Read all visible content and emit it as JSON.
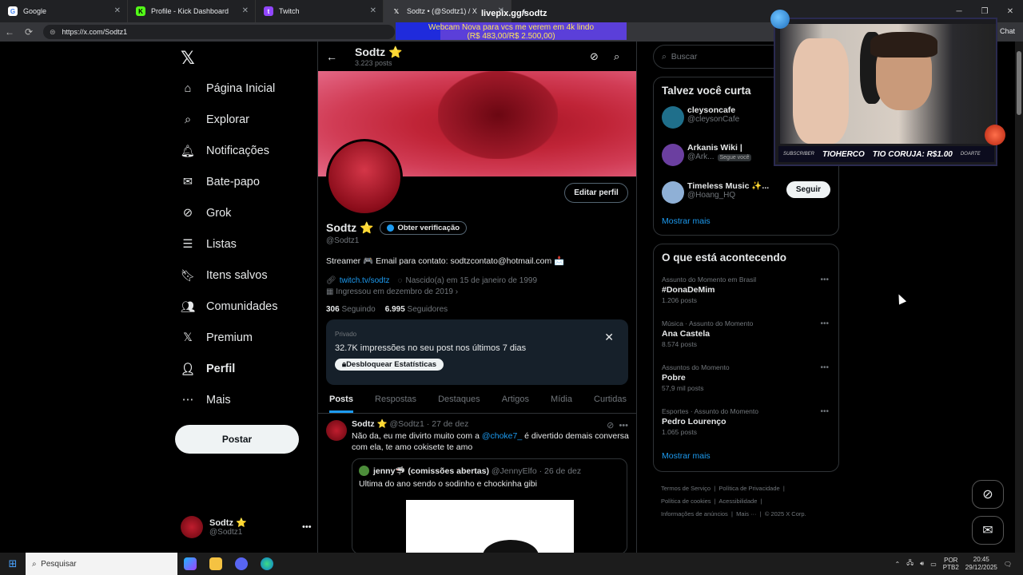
{
  "browser": {
    "tabs": [
      {
        "title": "Google",
        "icon": "google-icon",
        "color": "#ffffff"
      },
      {
        "title": "Profile - Kick Dashboard",
        "icon": "kick-icon",
        "color": "#53fc18"
      },
      {
        "title": "Twitch",
        "icon": "twitch-icon",
        "color": "#9146ff"
      },
      {
        "title": "Sodtz • (@Sodtz1) / X",
        "icon": "x-icon",
        "color": "#ffffff"
      }
    ],
    "overlay_title": "livepix.gg/sodtz",
    "url": "https://x.com/Sodtz1",
    "chat_label": "Chat"
  },
  "banner": {
    "line1": "Webcam Nova para vcs me verem em 4k lindo",
    "line2": "(R$ 483,00/R$ 2.500,00)",
    "progress": 0.1932
  },
  "sidebar": {
    "logo": "X",
    "items": [
      {
        "label": "Página Inicial",
        "icon": "home-icon"
      },
      {
        "label": "Explorar",
        "icon": "search-icon"
      },
      {
        "label": "Notificações",
        "icon": "bell-icon"
      },
      {
        "label": "Bate-papo",
        "icon": "mail-icon"
      },
      {
        "label": "Grok",
        "icon": "grok-icon"
      },
      {
        "label": "Listas",
        "icon": "list-icon"
      },
      {
        "label": "Itens salvos",
        "icon": "bookmark-icon"
      },
      {
        "label": "Comunidades",
        "icon": "people-icon"
      },
      {
        "label": "Premium",
        "icon": "x-premium-icon"
      },
      {
        "label": "Perfil",
        "icon": "person-icon"
      },
      {
        "label": "Mais",
        "icon": "more-circle-icon"
      }
    ],
    "post_button": "Postar",
    "account": {
      "name": "Sodtz ⭐",
      "handle": "@Sodtz1"
    }
  },
  "profile": {
    "name": "Sodtz ⭐",
    "posts_count": "3.223 posts",
    "edit_button": "Editar perfil",
    "verify_button": "Obter verificação",
    "handle": "@Sodtz1",
    "bio": "Streamer 🎮 Email para contato: sodtzcontato@hotmail.com 📩",
    "link": "twitch.tv/sodtz",
    "birth": "Nascido(a) em 15 de janeiro de 1999",
    "joined": "Ingressou em dezembro de 2019",
    "following_count": "306",
    "following_label": "Seguindo",
    "followers_count": "6.995",
    "followers_label": "Seguidores"
  },
  "private_card": {
    "label": "Privado",
    "text": "32.7K impressões no seu post nos últimos 7 dias",
    "button": "Desbloquear Estatísticas"
  },
  "tabs": [
    "Posts",
    "Respostas",
    "Destaques",
    "Artigos",
    "Mídia",
    "Curtidas"
  ],
  "tweet": {
    "name": "Sodtz ⭐",
    "handle": "@Sodtz1",
    "date": "27 de dez",
    "text_before": "Não da, eu me divirto muito com a ",
    "mention": "@choke7_",
    "text_after": " é divertido demais conversa com ela, te amo cokisete te amo",
    "quote": {
      "name": "jenny🦈 (comissões abertas)",
      "handle": "@JennyElfo",
      "date": "26 de dez",
      "text": "Ultima do ano sendo o sodinho e chockinha gibi"
    }
  },
  "right": {
    "search_placeholder": "Buscar",
    "who_title": "Talvez você curta",
    "who": [
      {
        "name": "cleysoncafe",
        "handle": "@cleysonCafe",
        "color": "#1f6f8b"
      },
      {
        "name": "Arkanis Wiki |",
        "handle": "@Ark...",
        "badge": "Segue você",
        "color": "#6b3fa0"
      },
      {
        "name": "Timeless Music ✨...",
        "handle": "@Hoang_HQ",
        "color": "#8fb0d6",
        "button": "Seguir"
      }
    ],
    "show_more": "Mostrar mais",
    "trends_title": "O que está acontecendo",
    "trends": [
      {
        "context": "Assunto do Momento em Brasil",
        "topic": "#DonaDeMim",
        "posts": "1.206 posts"
      },
      {
        "context": "Música · Assunto do Momento",
        "topic": "Ana Castela",
        "posts": "8.574 posts"
      },
      {
        "context": "Assuntos do Momento",
        "topic": "Pobre",
        "posts": "57,9 mil posts"
      },
      {
        "context": "Esportes · Assunto do Momento",
        "topic": "Pedro Lourenço",
        "posts": "1.065 posts"
      }
    ],
    "trends_more": "Mostrar mais",
    "footer": [
      "Termos de Serviço",
      "Política de Privacidade",
      "Política de cookies",
      "Acessibilidade",
      "Informações de anúncios",
      "Mais ···",
      "© 2025 X Corp."
    ]
  },
  "webcam": {
    "subscriber_label": "SUBSCRIBER",
    "subscriber": "TIOHERCO",
    "donation": "TIO CORUJA: R$1.00",
    "donate_label": "DOARTE"
  },
  "taskbar": {
    "search": "Pesquisar",
    "lang1": "POR",
    "lang2": "PTB2",
    "time": "20:45",
    "date": "29/12/2025"
  }
}
